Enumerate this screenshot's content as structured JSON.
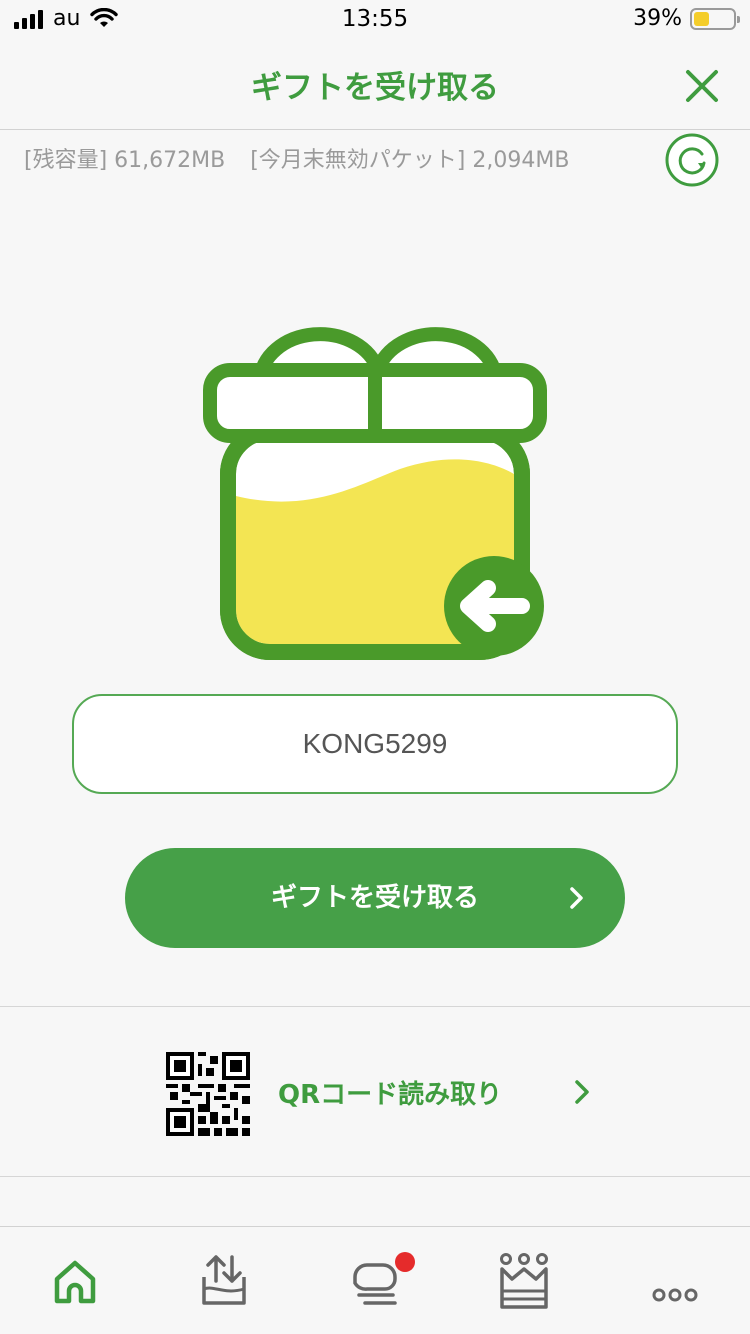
{
  "status_bar": {
    "carrier": "au",
    "time": "13:55",
    "battery_percent": "39%",
    "battery_level": 0.39
  },
  "header": {
    "title": "ギフトを受け取る",
    "close_icon": "close-icon"
  },
  "data_info": {
    "remaining": "[残容量] 61,672MB",
    "expiring": "[今月末無効パケット] 2,094MB",
    "refresh_icon": "refresh-icon"
  },
  "gift_code": {
    "value": "KONG5299"
  },
  "receive_button": {
    "label": "ギフトを受け取る"
  },
  "qr": {
    "label": "QRコード読み取り"
  },
  "tabs": [
    {
      "icon": "home-icon",
      "active": true
    },
    {
      "icon": "data-transfer-icon",
      "active": false
    },
    {
      "icon": "message-icon",
      "active": false,
      "badge": true
    },
    {
      "icon": "crown-icon",
      "active": false
    },
    {
      "icon": "more-icon",
      "active": false
    }
  ],
  "colors": {
    "brand_green": "#3f9c3f",
    "button_green": "#46a048",
    "gift_yellow": "#f3e553",
    "badge_red": "#e52b2b"
  }
}
